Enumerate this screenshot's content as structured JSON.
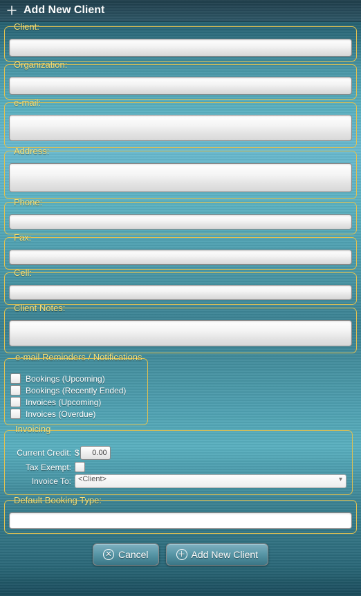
{
  "header": {
    "title": "Add New Client"
  },
  "fields": {
    "client": {
      "label": "Client:",
      "value": ""
    },
    "organization": {
      "label": "Organization:",
      "value": ""
    },
    "email": {
      "label": "e-mail:",
      "value": ""
    },
    "address": {
      "label": "Address:",
      "value": ""
    },
    "phone": {
      "label": "Phone:",
      "value": ""
    },
    "fax": {
      "label": "Fax:",
      "value": ""
    },
    "cell": {
      "label": "Cell:",
      "value": ""
    },
    "client_notes": {
      "label": "Client Notes:",
      "value": ""
    },
    "default_booking_type": {
      "label": "Default Booking Type:",
      "value": ""
    }
  },
  "notifications": {
    "legend": "e-mail Reminders / Notifications",
    "items": {
      "bookings_upcoming": {
        "label": "Bookings (Upcoming)"
      },
      "bookings_ended": {
        "label": "Bookings (Recently Ended)"
      },
      "invoices_upcoming": {
        "label": "Invoices (Upcoming)"
      },
      "invoices_overdue": {
        "label": "Invoices (Overdue)"
      }
    }
  },
  "invoicing": {
    "legend": "Invoicing",
    "current_credit_label": "Current Credit:",
    "current_credit_value": "0.00",
    "tax_exempt_label": "Tax Exempt:",
    "invoice_to_label": "Invoice To:",
    "invoice_to_value": "<Client>"
  },
  "buttons": {
    "cancel": "Cancel",
    "add": "Add New Client"
  }
}
